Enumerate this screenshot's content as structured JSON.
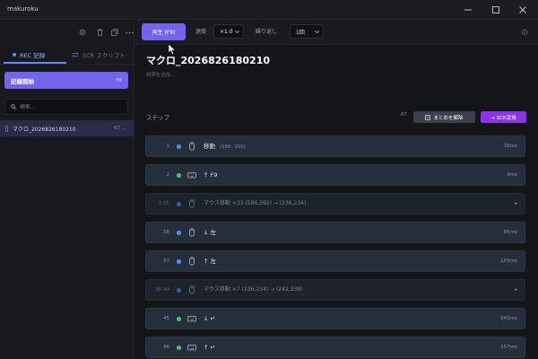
{
  "window": {
    "title": "makuroku"
  },
  "sidebar": {
    "icons": [
      "settings-icon",
      "trash-icon",
      "copy-icon",
      "more-icon"
    ],
    "tabs": [
      {
        "label": "REC 記録",
        "icon": "record-dot-icon",
        "active": true
      },
      {
        "label": "SCR スクリプト",
        "icon": "swap-icon",
        "active": false
      }
    ],
    "record_button": {
      "label": "記録開始",
      "shortcut": "F8"
    },
    "search": {
      "placeholder": "検索...",
      "value": ""
    },
    "macros": [
      {
        "name": "マクロ_2026826180210",
        "count": "67 ...",
        "selected": true
      }
    ]
  },
  "toolbar": {
    "play_label": "再生 (F9)",
    "speed_label": "速度",
    "speed_value": "×1.0",
    "repeat_label": "繰り返し",
    "repeat_value": "1回"
  },
  "macro": {
    "title": "マクロ_2026826180210",
    "description_placeholder": "説明を追加..."
  },
  "steps": {
    "heading": "ステップ",
    "count": "67",
    "ungroup_label": "まとめを解除",
    "convert_label": "→ SCR変換",
    "items": [
      {
        "index": "1",
        "icon": "mouse-icon",
        "dot": "mouse",
        "label": "移動",
        "detail": "(586, 392)",
        "trailing": "35ms",
        "grouped": false
      },
      {
        "index": "2",
        "icon": "keyboard-icon",
        "dot": "key",
        "label": "↑ F9",
        "detail": "",
        "trailing": "4ms",
        "grouped": false
      },
      {
        "index": "3-35",
        "icon": "mouse-icon",
        "dot": "mouse",
        "label": "マウス移動 ×33 (586,392) → (236,234)",
        "detail": "",
        "trailing": "▸",
        "grouped": true
      },
      {
        "index": "36",
        "icon": "mouse-icon",
        "dot": "mouse",
        "label": "↓ 左",
        "detail": "",
        "trailing": "85ms",
        "grouped": false
      },
      {
        "index": "37",
        "icon": "mouse-icon",
        "dot": "mouse",
        "label": "↑ 左",
        "detail": "",
        "trailing": "105ms",
        "grouped": false
      },
      {
        "index": "38-44",
        "icon": "mouse-icon",
        "dot": "mouse",
        "label": "マウス移動 ×7 (236,234) → (242,238)",
        "detail": "",
        "trailing": "▸",
        "grouped": true
      },
      {
        "index": "45",
        "icon": "keyboard-icon",
        "dot": "key",
        "label": "↓ ↵",
        "detail": "",
        "trailing": "543ms",
        "grouped": false
      },
      {
        "index": "46",
        "icon": "keyboard-icon",
        "dot": "key",
        "label": "↑ ↵",
        "detail": "",
        "trailing": "157ms",
        "grouped": false
      }
    ]
  },
  "colors": {
    "accent": "#7364ee",
    "convert": "#8b35e8",
    "mouse_dot": "#4f8ff7",
    "key_dot": "#3ec46d"
  }
}
